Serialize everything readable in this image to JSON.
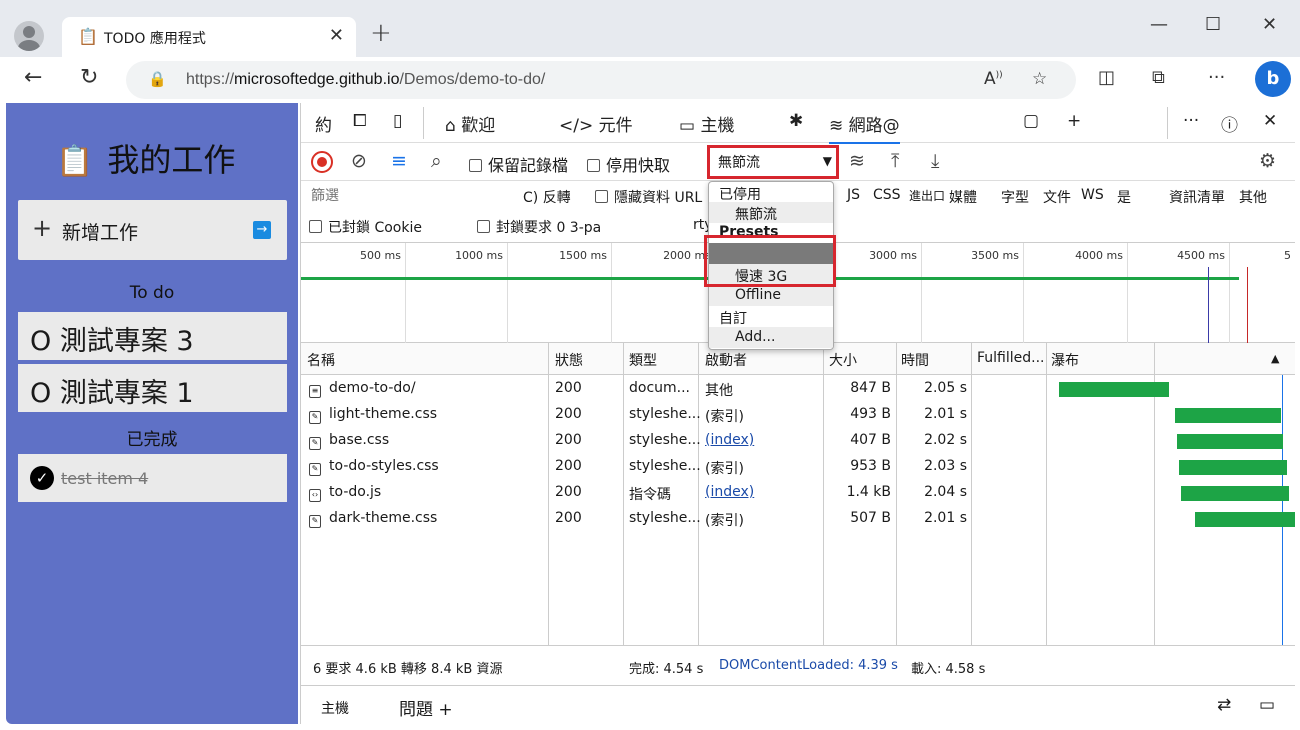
{
  "browser": {
    "tab_title": "TODO 應用程式",
    "tab_close": "✕",
    "new_tab": "+",
    "url_host": "microsoftedge.github.io",
    "url_prefix": "https://",
    "url_path": "/Demos/demo-to-do/"
  },
  "app": {
    "title": "我的工作",
    "new_task_label": "新增工作",
    "todo_header": "To do",
    "todos": [
      "O 測試專案 3",
      "O 測試專案 1"
    ],
    "done_header": "已完成",
    "done_items": [
      "test item 4"
    ]
  },
  "devtools": {
    "tabs": [
      "約",
      "歡迎",
      "元件",
      "主機",
      "網路@"
    ],
    "toolbar": {
      "preserve_log": "保留記錄檔",
      "disable_cache": "停用快取",
      "throttle_value": "無節流"
    },
    "filter": {
      "placeholder": "篩選",
      "invert": "C) 反轉",
      "hide_data_urls": "隱藏資料 URL",
      "types": [
        "JS",
        "CSS",
        "進出口",
        "媒體",
        "字型",
        "文件",
        "WS",
        "是",
        "資訊清單",
        "其他"
      ],
      "blocked_cookies": "已封鎖 Cookie",
      "blocked_requests": "封鎖要求 0 3-pa",
      "third_party_suffix": "rty"
    },
    "timeline_ticks": [
      "500 ms",
      "1000 ms",
      "1500 ms",
      "2000 ms",
      "3000 ms",
      "3500 ms",
      "4000 ms",
      "4500 ms",
      "5"
    ],
    "columns": [
      "名稱",
      "狀態",
      "類型",
      "啟動者",
      "大小",
      "時間",
      "Fulfilled...",
      "瀑布"
    ],
    "rows": [
      {
        "name": "demo-to-do/",
        "status": "200",
        "type": "docum...",
        "initiator": "其他",
        "initiator_link": false,
        "size": "847 B",
        "time": "2.05 s",
        "icon": "document-icon"
      },
      {
        "name": "light-theme.css",
        "status": "200",
        "type": "styleshe...",
        "initiator": "(索引)",
        "initiator_link": false,
        "size": "493 B",
        "time": "2.01 s",
        "icon": "stylesheet-icon"
      },
      {
        "name": "base.css",
        "status": "200",
        "type": "styleshe...",
        "initiator": "(index)",
        "initiator_link": true,
        "size": "407 B",
        "time": "2.02 s",
        "icon": "stylesheet-icon"
      },
      {
        "name": "to-do-styles.css",
        "status": "200",
        "type": "styleshe...",
        "initiator": "(索引)",
        "initiator_link": false,
        "size": "953 B",
        "time": "2.03 s",
        "icon": "stylesheet-icon"
      },
      {
        "name": "to-do.js",
        "status": "200",
        "type": "指令碼",
        "initiator": "(index)",
        "initiator_link": true,
        "size": "1.4 kB",
        "time": "2.04 s",
        "icon": "script-icon"
      },
      {
        "name": "dark-theme.css",
        "status": "200",
        "type": "styleshe...",
        "initiator": "(索引)",
        "initiator_link": false,
        "size": "507 B",
        "time": "2.01 s",
        "icon": "stylesheet-icon"
      }
    ],
    "status_bar": {
      "requests": "6 要求 4.6 kB 轉移 8.4 kB 資源",
      "finish": "完成: 4.54 s",
      "dom_loaded": "DOMContentLoaded: 4.39 s",
      "load": "載入: 4.58 s"
    },
    "drawer_tabs": [
      "主機",
      "問題 +"
    ],
    "throttle_menu": {
      "group_disabled": "已停用",
      "no_throttle": "無節流",
      "presets_header": "Presets",
      "fast3g": "",
      "slow3g": "慢速 3G",
      "offline": "Offline",
      "custom_header": "自訂",
      "add": "Add..."
    }
  }
}
